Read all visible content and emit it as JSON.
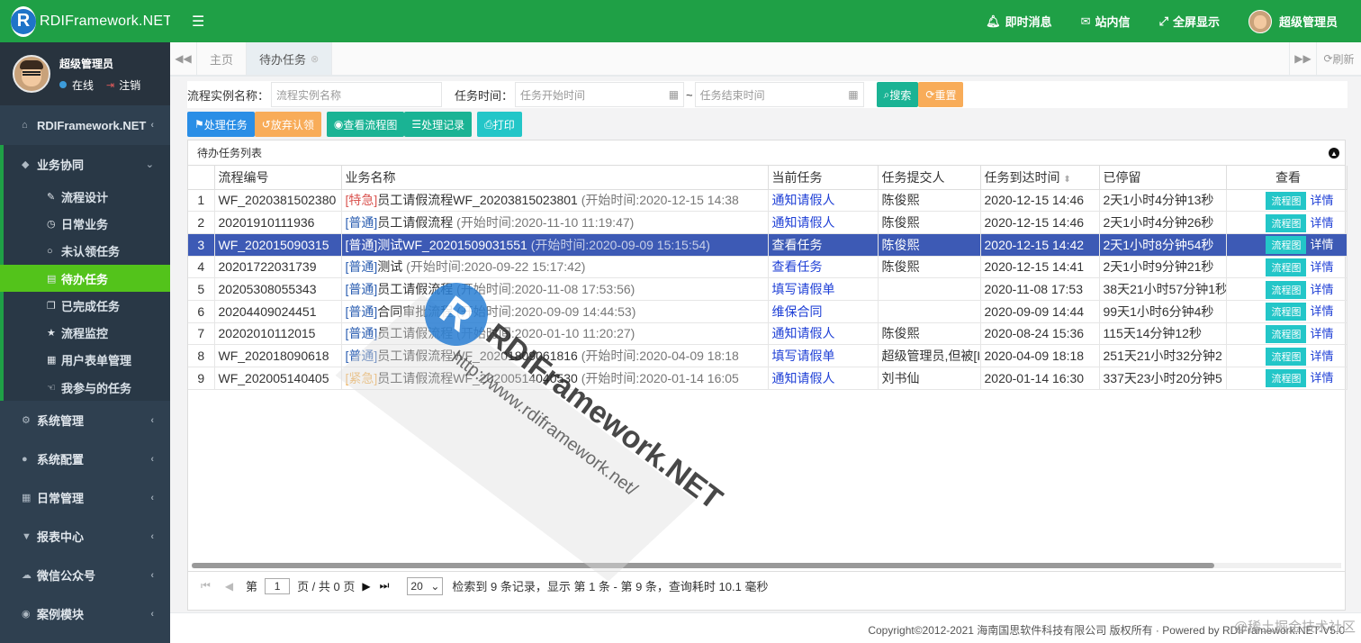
{
  "app": {
    "logo_letter": "R",
    "logo_text": "RDIFramework.NET"
  },
  "user": {
    "name": "超级管理员",
    "status": "在线",
    "logout": "注销"
  },
  "sidebar": {
    "top_items": [
      {
        "label": "RDIFramework.NET",
        "icon": "home-icon"
      }
    ],
    "open_group": {
      "label": "业务协同",
      "icon": "cube-icon"
    },
    "sub_items": [
      {
        "label": "流程设计",
        "icon": "edit-icon"
      },
      {
        "label": "日常业务",
        "icon": "clock-icon"
      },
      {
        "label": "未认领任务",
        "icon": "circle-icon"
      },
      {
        "label": "待办任务",
        "icon": "list-icon"
      },
      {
        "label": "已完成任务",
        "icon": "copy-icon"
      },
      {
        "label": "流程监控",
        "icon": "star-icon"
      },
      {
        "label": "用户表单管理",
        "icon": "form-icon"
      },
      {
        "label": "我参与的任务",
        "icon": "hand-icon"
      }
    ],
    "bottom_items": [
      {
        "label": "系统管理",
        "icon": "gears-icon"
      },
      {
        "label": "系统配置",
        "icon": "cog-icon"
      },
      {
        "label": "日常管理",
        "icon": "calendar-icon"
      },
      {
        "label": "报表中心",
        "icon": "filter-icon"
      },
      {
        "label": "微信公众号",
        "icon": "wechat-icon"
      },
      {
        "label": "案例模块",
        "icon": "eye-icon"
      }
    ]
  },
  "topbar": {
    "notify": "即时消息",
    "inbox": "站内信",
    "fullscreen": "全屏显示",
    "user": "超级管理员"
  },
  "tabs": [
    {
      "label": "主页"
    },
    {
      "label": "待办任务"
    }
  ],
  "refresh_label": "刷新",
  "search": {
    "name_label": "流程实例名称：",
    "name_placeholder": "流程实例名称",
    "time_label": "任务时间：",
    "start_placeholder": "任务开始时间",
    "sep": "~",
    "end_placeholder": "任务结束时间",
    "search_btn": "搜索",
    "reset_btn": "重置"
  },
  "toolbar": {
    "handle": "处理任务",
    "abandon": "放弃认领",
    "view_flow": "查看流程图",
    "records": "处理记录",
    "print": "打印"
  },
  "panel_title": "待办任务列表",
  "table": {
    "columns": [
      "",
      "流程编号",
      "业务名称",
      "当前任务",
      "任务提交人",
      "任务到达时间",
      "已停留",
      "查看"
    ],
    "sort_icon": "sort-icon",
    "flow_btn": "流程图",
    "detail": "详情",
    "rows": [
      {
        "n": "1",
        "code": "WF_2020381502380",
        "tag": "[特急]",
        "tag_type": "urgent",
        "biz": "员工请假流程WF_20203815023801",
        "start": "(开始时间:2020-12-15 14:38",
        "task": "通知请假人",
        "submitter": "陈俊熙",
        "arrive": "2020-12-15 14:46",
        "stay": "2天1小时4分钟13秒"
      },
      {
        "n": "2",
        "code": "20201910111936",
        "tag": "[普通]",
        "tag_type": "normal",
        "biz": "员工请假流程",
        "start": "(开始时间:2020-11-10 11:19:47)",
        "task": "通知请假人",
        "submitter": "陈俊熙",
        "arrive": "2020-12-15 14:46",
        "stay": "2天1小时4分钟26秒"
      },
      {
        "n": "3",
        "code": "WF_202015090315",
        "tag": "[普通]",
        "tag_type": "normal",
        "biz": "测试WF_20201509031551",
        "start": "(开始时间:2020-09-09 15:15:54)",
        "task": "查看任务",
        "submitter": "陈俊熙",
        "arrive": "2020-12-15 14:42",
        "stay": "2天1小时8分钟54秒"
      },
      {
        "n": "4",
        "code": "20201722031739",
        "tag": "[普通]",
        "tag_type": "normal",
        "biz": "测试",
        "start": "(开始时间:2020-09-22 15:17:42)",
        "task": "查看任务",
        "submitter": "陈俊熙",
        "arrive": "2020-12-15 14:41",
        "stay": "2天1小时9分钟21秒"
      },
      {
        "n": "5",
        "code": "20205308055343",
        "tag": "[普通]",
        "tag_type": "normal",
        "biz": "员工请假流程",
        "start": "(开始时间:2020-11-08 17:53:56)",
        "task": "填写请假单",
        "submitter": "",
        "arrive": "2020-11-08 17:53",
        "stay": "38天21小时57分钟1秒"
      },
      {
        "n": "6",
        "code": "20204409024451",
        "tag": "[普通]",
        "tag_type": "normal",
        "biz": "合同审批流程",
        "start": "(开始时间:2020-09-09 14:44:53)",
        "task": "维保合同",
        "submitter": "",
        "arrive": "2020-09-09 14:44",
        "stay": "99天1小时6分钟4秒"
      },
      {
        "n": "7",
        "code": "20202010112015",
        "tag": "[普通]",
        "tag_type": "normal",
        "biz": "员工请假流程",
        "start": "(开始时间:2020-01-10 11:20:27)",
        "task": "通知请假人",
        "submitter": "陈俊熙",
        "arrive": "2020-08-24 15:36",
        "stay": "115天14分钟12秒"
      },
      {
        "n": "8",
        "code": "WF_202018090618",
        "tag": "[普通]",
        "tag_type": "normal",
        "biz": "员工请假流程WF_20201809061816",
        "start": "(开始时间:2020-04-09 18:18",
        "task": "填写请假单",
        "submitter": "超级管理员,但被[I",
        "arrive": "2020-04-09 18:18",
        "stay": "251天21小时32分钟2"
      },
      {
        "n": "9",
        "code": "WF_202005140405",
        "tag": "[紧急]",
        "tag_type": "critical",
        "biz": "员工请假流程WF_20200514040530",
        "start": "(开始时间:2020-01-14 16:05",
        "task": "通知请假人",
        "submitter": "刘书仙",
        "arrive": "2020-01-14 16:30",
        "stay": "337天23小时20分钟5"
      }
    ]
  },
  "pager": {
    "page_label": "第",
    "page": "1",
    "of_label": "页 / 共 0 页",
    "page_size": "20",
    "summary": "检索到 9 条记录，显示 第 1 条 - 第 9 条，查询耗时 10.1 毫秒"
  },
  "footer": {
    "copyright": "Copyright©2012-2021 海南国思软件科技有限公司 版权所有 · Powered by RDIFramework.NET-V5.0",
    "juejin": "@稀土掘金技术社区"
  },
  "watermark": {
    "text": "RDIFramework.NET",
    "url": "http://www.rdiframework.net/"
  },
  "colors": {
    "brand_green": "#1fa046",
    "sidebar_bg": "#2f4050",
    "active_item": "#53c31b",
    "selected_row": "#3d5ab5"
  }
}
